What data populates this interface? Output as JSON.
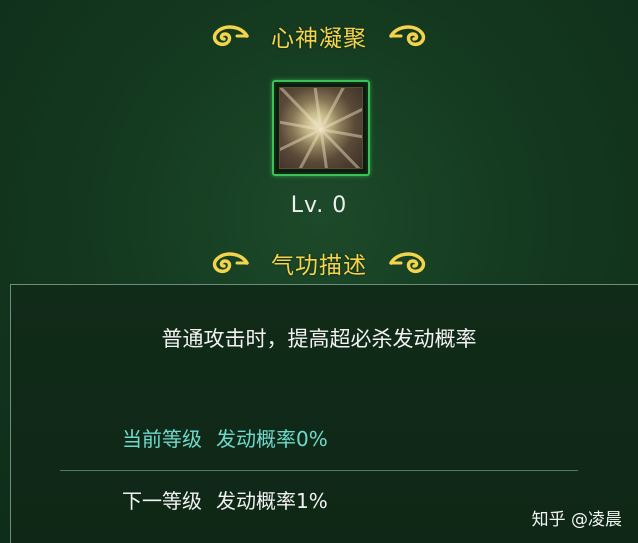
{
  "skill": {
    "name": "心神凝聚",
    "level_text": "Lv. 0",
    "icon": "radiant-burst-icon"
  },
  "description": {
    "header": "气功描述",
    "text": "普通攻击时，提高超必杀发动概率"
  },
  "stats": {
    "current": {
      "label": "当前等级",
      "value": "发动概率0%"
    },
    "next": {
      "label": "下一等级",
      "value": "发动概率1%"
    }
  },
  "watermark": "知乎 @凌晨",
  "colors": {
    "header_gold": "#f4d44a",
    "current_teal": "#6fd9cc",
    "frame_green": "#3cc05a",
    "background": "#143a20"
  }
}
